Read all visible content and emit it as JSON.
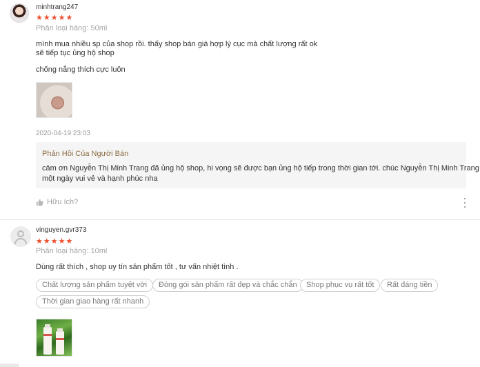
{
  "reviews": [
    {
      "username": "minhtrang247",
      "stars": "★★★★★",
      "variation": "Phân loại hàng: 50ml",
      "comment_lines": [
        "mình mua nhiều sp của shop rồi. thấy shop bán giá hợp lý cục mà chất lượng rất ok",
        "sẽ tiếp tục ủng hộ shop",
        "chống nắng thích cực luôn"
      ],
      "timestamp": "2020-04-19 23:03",
      "seller_reply": {
        "title": "Phản Hồi Của Người Bán",
        "lines": [
          "cảm ơn Nguyễn Thị Minh Trang đã ủng hộ shop, hi vọng sẽ được bạn ủng hộ tiếp trong thời gian tới. chúc Nguyễn Thị Minh Trang",
          "một ngày vui vẻ và hạnh phúc nha"
        ]
      },
      "helpful_label": "Hữu ích?"
    },
    {
      "username": "vinguyen.gvr373",
      "stars": "★★★★★",
      "variation": "Phân loại hàng: 10ml",
      "comment": "Dùng rất thích , shop uy tín sản phẩm tốt , tư vấn nhiệt tình .",
      "tags": [
        "Chất lượng sản phẩm tuyệt vời",
        "Đóng gói sản phẩm rất đẹp và chắc chắn",
        "Shop phục vụ rất tốt",
        "Rất đáng tiền",
        "Thời gian giao hàng rất nhanh"
      ]
    }
  ],
  "icons": {
    "avatar_default": "user-silhouette-icon",
    "helpful": "thumbs-up-icon",
    "more": "more-vertical-icon"
  },
  "colors": {
    "star": "#ee4d2d",
    "seller_title": "#8b6b42",
    "seller_bg": "#f5f5f5"
  }
}
